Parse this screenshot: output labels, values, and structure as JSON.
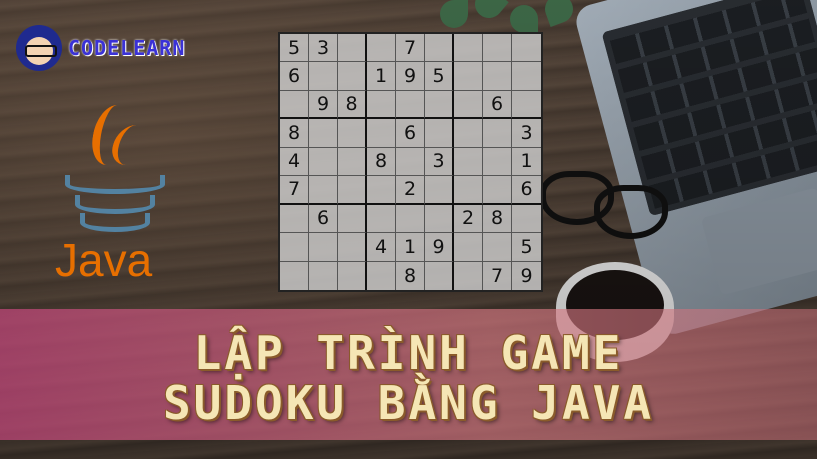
{
  "brand": {
    "name": "CODELEARN"
  },
  "java_logo": {
    "text": "Java",
    "color": "#e76f00",
    "icon": "java-coffee-cup-icon"
  },
  "sudoku": {
    "grid": [
      [
        "5",
        "3",
        "",
        "",
        "7",
        "",
        "",
        "",
        ""
      ],
      [
        "6",
        "",
        "",
        "1",
        "9",
        "5",
        "",
        "",
        ""
      ],
      [
        "",
        "9",
        "8",
        "",
        "",
        "",
        "",
        "6",
        ""
      ],
      [
        "8",
        "",
        "",
        "",
        "6",
        "",
        "",
        "",
        "3"
      ],
      [
        "4",
        "",
        "",
        "8",
        "",
        "3",
        "",
        "",
        "1"
      ],
      [
        "7",
        "",
        "",
        "",
        "2",
        "",
        "",
        "",
        "6"
      ],
      [
        "",
        "6",
        "",
        "",
        "",
        "",
        "2",
        "8",
        ""
      ],
      [
        "",
        "",
        "",
        "4",
        "1",
        "9",
        "",
        "",
        "5"
      ],
      [
        "",
        "",
        "",
        "",
        "8",
        "",
        "",
        "7",
        "9"
      ]
    ]
  },
  "title": {
    "line1": "LẬP TRÌNH GAME",
    "line2": "SUDOKU BẰNG JAVA"
  },
  "colors": {
    "banner": "#c85a86",
    "title_text": "#f5e6b5",
    "brand_text": "#3b32d6"
  }
}
